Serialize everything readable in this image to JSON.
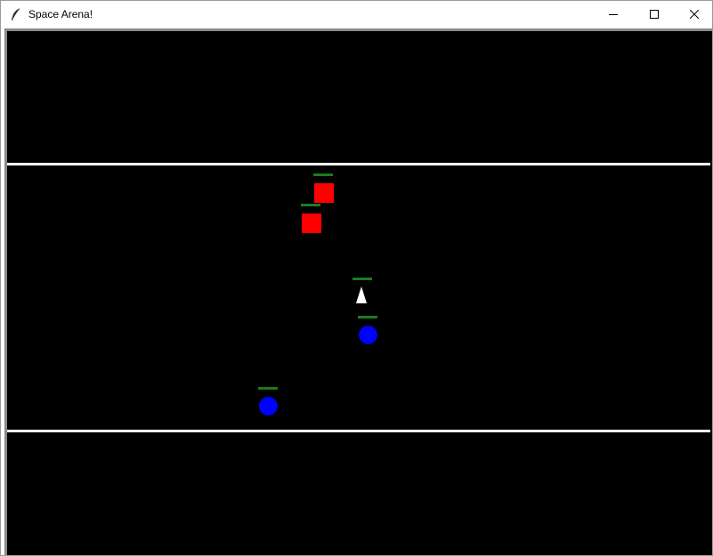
{
  "window": {
    "title": "Space Arena!",
    "app_icon": "feather-icon",
    "controls": {
      "minimize_icon": "minimize-icon",
      "maximize_icon": "maximize-icon",
      "close_icon": "close-icon"
    }
  },
  "arena": {
    "background_color": "#000000",
    "boundary_color": "#ffffff",
    "health_bar_color": "#1e7a1e",
    "enemy_color": "#ff0000",
    "ally_color": "#0000ff",
    "player_color": "#ffffff",
    "entities": [
      {
        "kind": "enemy",
        "shape": "square",
        "health": 1.0
      },
      {
        "kind": "enemy",
        "shape": "square",
        "health": 1.0
      },
      {
        "kind": "player",
        "shape": "triangle",
        "health": 1.0
      },
      {
        "kind": "ally",
        "shape": "circle",
        "health": 1.0
      },
      {
        "kind": "ally",
        "shape": "circle",
        "health": 1.0
      }
    ]
  }
}
